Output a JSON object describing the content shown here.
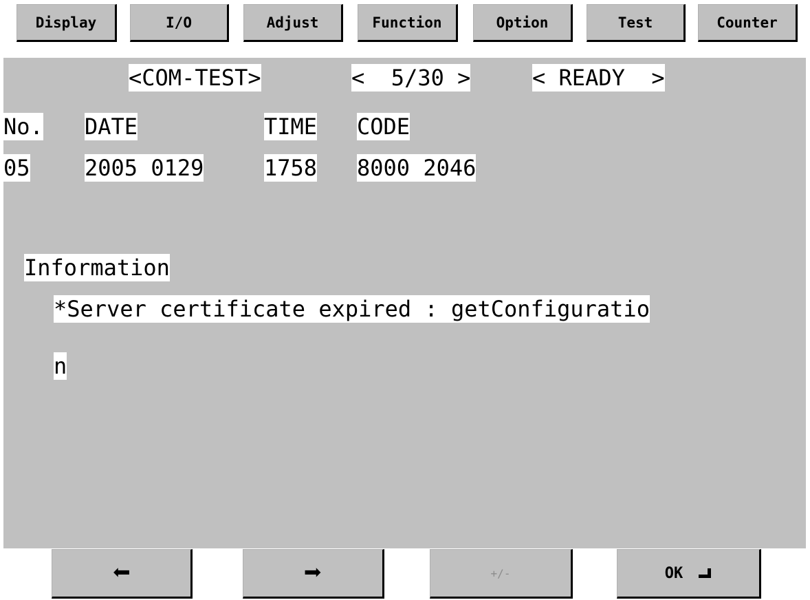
{
  "tabs": [
    "Display",
    "I/O",
    "Adjust",
    "Function",
    "Option",
    "Test",
    "Counter"
  ],
  "header": {
    "mode": "<COM-TEST>",
    "page": "<  5/30 >",
    "status": "< READY  >"
  },
  "columns": {
    "no": "No.",
    "date": "DATE",
    "time": "TIME",
    "code": "CODE"
  },
  "record": {
    "no": "05",
    "date": "2005 0129",
    "time": "1758",
    "code": "8000 2046"
  },
  "info": {
    "heading": "Information",
    "line1": "*Server certificate expired : getConfiguratio",
    "line2": "n"
  },
  "bottom": {
    "prev_icon": "left-arrow-icon",
    "next_icon": "right-arrow-icon",
    "plusminus_label": "+/-",
    "ok_label": "OK",
    "enter_icon": "enter-icon"
  }
}
